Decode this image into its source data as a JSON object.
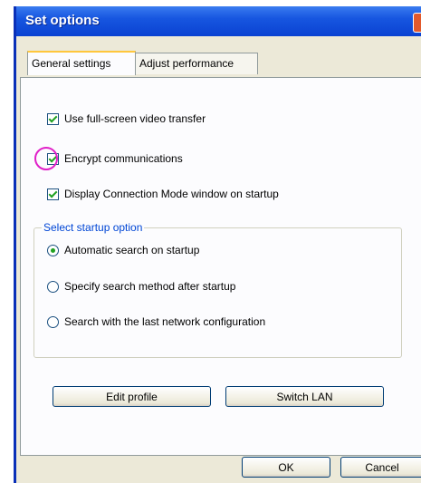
{
  "window": {
    "title": "Set options"
  },
  "tabs": [
    {
      "label": "General settings",
      "active": true
    },
    {
      "label": "Adjust performance",
      "active": false
    }
  ],
  "options": {
    "full_screen_video": {
      "label": "Use full-screen video transfer",
      "checked": true
    },
    "encrypt": {
      "label": "Encrypt communications",
      "checked": true
    },
    "display_connection_mode": {
      "label": "Display Connection Mode window on startup",
      "checked": true
    }
  },
  "startup_group": {
    "title": "Select startup option",
    "options": [
      {
        "label": "Automatic search on startup",
        "selected": true
      },
      {
        "label": "Specify search method after startup",
        "selected": false
      },
      {
        "label": "Search with the last network configuration",
        "selected": false
      }
    ]
  },
  "buttons": {
    "edit_profile": "Edit profile",
    "switch_lan": "Switch LAN",
    "ok": "OK",
    "cancel": "Cancel"
  },
  "colors": {
    "titlebar": "#0a42d2",
    "highlight_ring": "#e020c8",
    "group_title": "#0046d5",
    "active_tab_accent": "#ffc73c"
  }
}
